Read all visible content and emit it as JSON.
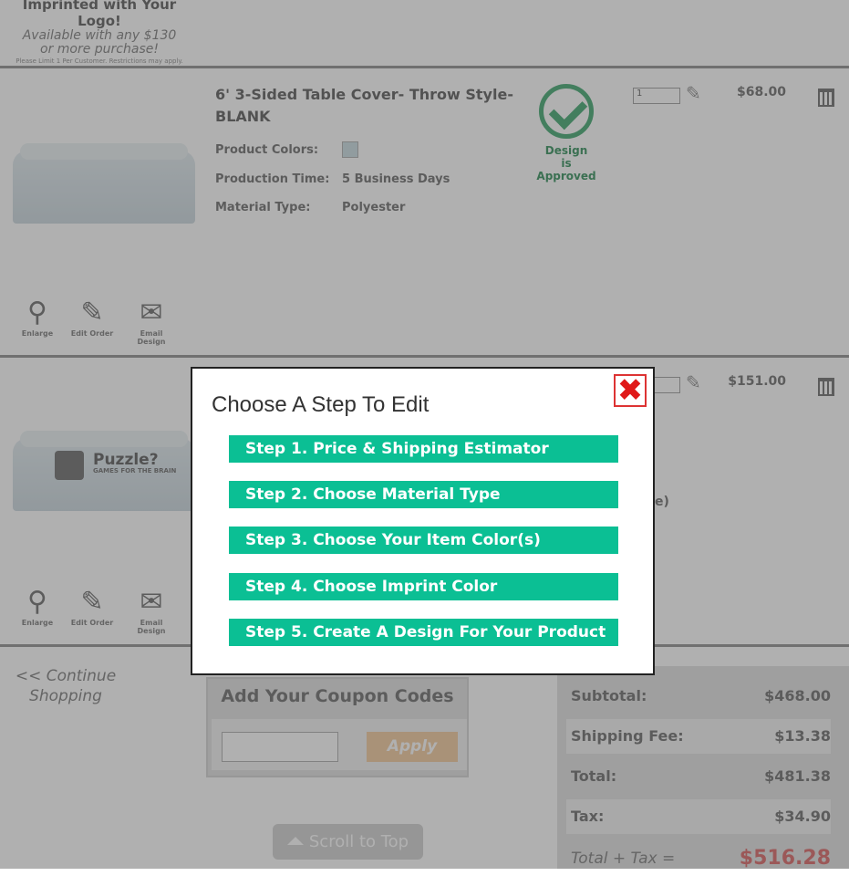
{
  "promo": {
    "title": "Imprinted with Your Logo!",
    "line2": "Available with any $130",
    "line3": "or more purchase!",
    "fine_print": "Please Limit 1 Per Customer. Restrictions may apply."
  },
  "items": [
    {
      "title": "6' 3-Sided Table Cover- Throw Style- BLANK",
      "attrs": {
        "colors_label": "Product Colors:",
        "time_label": "Production Time:",
        "time_value": "5 Business Days",
        "material_label": "Material Type:",
        "material_value": "Polyester"
      },
      "approved": [
        "Design",
        "is",
        "Approved"
      ],
      "qty": "1",
      "price": "$68.00"
    },
    {
      "price": "$151.00",
      "logo_text": "Puzzle?",
      "logo_sub": "GAMES FOR THE BRAIN",
      "partial_text": "e)"
    }
  ],
  "actions": {
    "enlarge": "Enlarge",
    "edit_order": "Edit Order",
    "email_design": "Email Design"
  },
  "continue_shopping": "<< Continue Shopping",
  "coupon": {
    "heading": "Add Your Coupon Codes",
    "input_value": "",
    "apply_label": "Apply"
  },
  "totals": {
    "subtotal_label": "Subtotal:",
    "subtotal": "$468.00",
    "shipping_label": "Shipping Fee:",
    "shipping": "$13.38",
    "total_label": "Total:",
    "total": "$481.38",
    "tax_label": "Tax:",
    "tax": "$34.90",
    "grand_label": "Total + Tax =",
    "grand": "$516.28"
  },
  "scroll_top": "Scroll to Top",
  "modal": {
    "title": "Choose A Step To Edit",
    "close_icon": "x-close-icon",
    "steps": [
      "Step 1. Price & Shipping Estimator",
      "Step 2. Choose Material Type",
      "Step 3. Choose Your Item Color(s)",
      "Step 4. Choose Imprint Color",
      "Step 5. Create A Design For Your Product"
    ]
  },
  "colors": {
    "step_button": "#0bbf94",
    "close_red": "#e01818",
    "approved_green": "#3aa56a",
    "grand_total": "#d96060"
  }
}
